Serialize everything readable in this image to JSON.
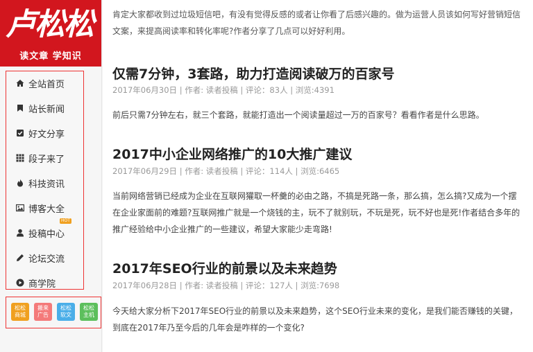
{
  "logo": {
    "brand": "卢松松",
    "slogan": "读文章 学知识"
  },
  "nav": [
    {
      "icon": "home-icon",
      "label": "全站首页"
    },
    {
      "icon": "bookmark-icon",
      "label": "站长新闻"
    },
    {
      "icon": "check-square-icon",
      "label": "好文分享"
    },
    {
      "icon": "grid-icon",
      "label": "段子来了"
    },
    {
      "icon": "fire-icon",
      "label": "科技资讯"
    },
    {
      "icon": "image-icon",
      "label": "博客大全"
    },
    {
      "icon": "user-icon",
      "label": "投稿中心",
      "badge": "HOT"
    },
    {
      "icon": "pencil-icon",
      "label": "论坛交流"
    },
    {
      "icon": "play-circle-icon",
      "label": "商学院"
    }
  ],
  "apps": [
    {
      "label": "松松商城",
      "color": "#f0a020"
    },
    {
      "label": "搬来广告",
      "color": "#f47a7a"
    },
    {
      "label": "松松软文",
      "color": "#4aaee8"
    },
    {
      "label": "松松主机",
      "color": "#5cbf5c"
    }
  ],
  "intro": "肯定大家都收到过垃圾短信吧，有没有觉得反感的或者让你看了后感兴趣的。做为运营人员该如何写好营销短信文案，来提高阅读率和转化率呢?作者分享了几点可以好好利用。",
  "articles": [
    {
      "title": "仅需7分钟，3套路，助力打造阅读破万的百家号",
      "meta": "2017年06月30日 | 作者: 读者投稿 | 评论：83人 | 浏览:4391",
      "summary": "前后只需7分钟左右，就三个套路，就能打造出一个阅读量超过一万的百家号？看看作者是什么思路。"
    },
    {
      "title": "2017中小企业网络推广的10大推广建议",
      "meta": "2017年06月29日 | 作者: 读者投稿 | 评论：114人 | 浏览:6465",
      "summary": "当前网络营销已经成为企业在互联网獾取一杯羹的必由之路，不搞是死路一条，那么搞，怎么搞?又成为一个摆在企业家面前的难题?互联网推广就是一个烧钱的主，玩不了就别玩，不玩是死，玩不好也是死!作者结合多年的推广经验给中小企业推广的一些建议，希望大家能少走弯路!"
    },
    {
      "title": "2017年SEO行业的前景以及未来趋势",
      "meta": "2017年06月28日 | 作者: 读者投稿 | 评论：127人 | 浏览:7698",
      "summary": "今天给大家分析下2017年SEO行业的前景以及未来趋势，这个SEO行业未来的变化，是我们能否赚钱的关键，到底在2017年乃至今后的几年会是咋样的一个变化?"
    }
  ]
}
